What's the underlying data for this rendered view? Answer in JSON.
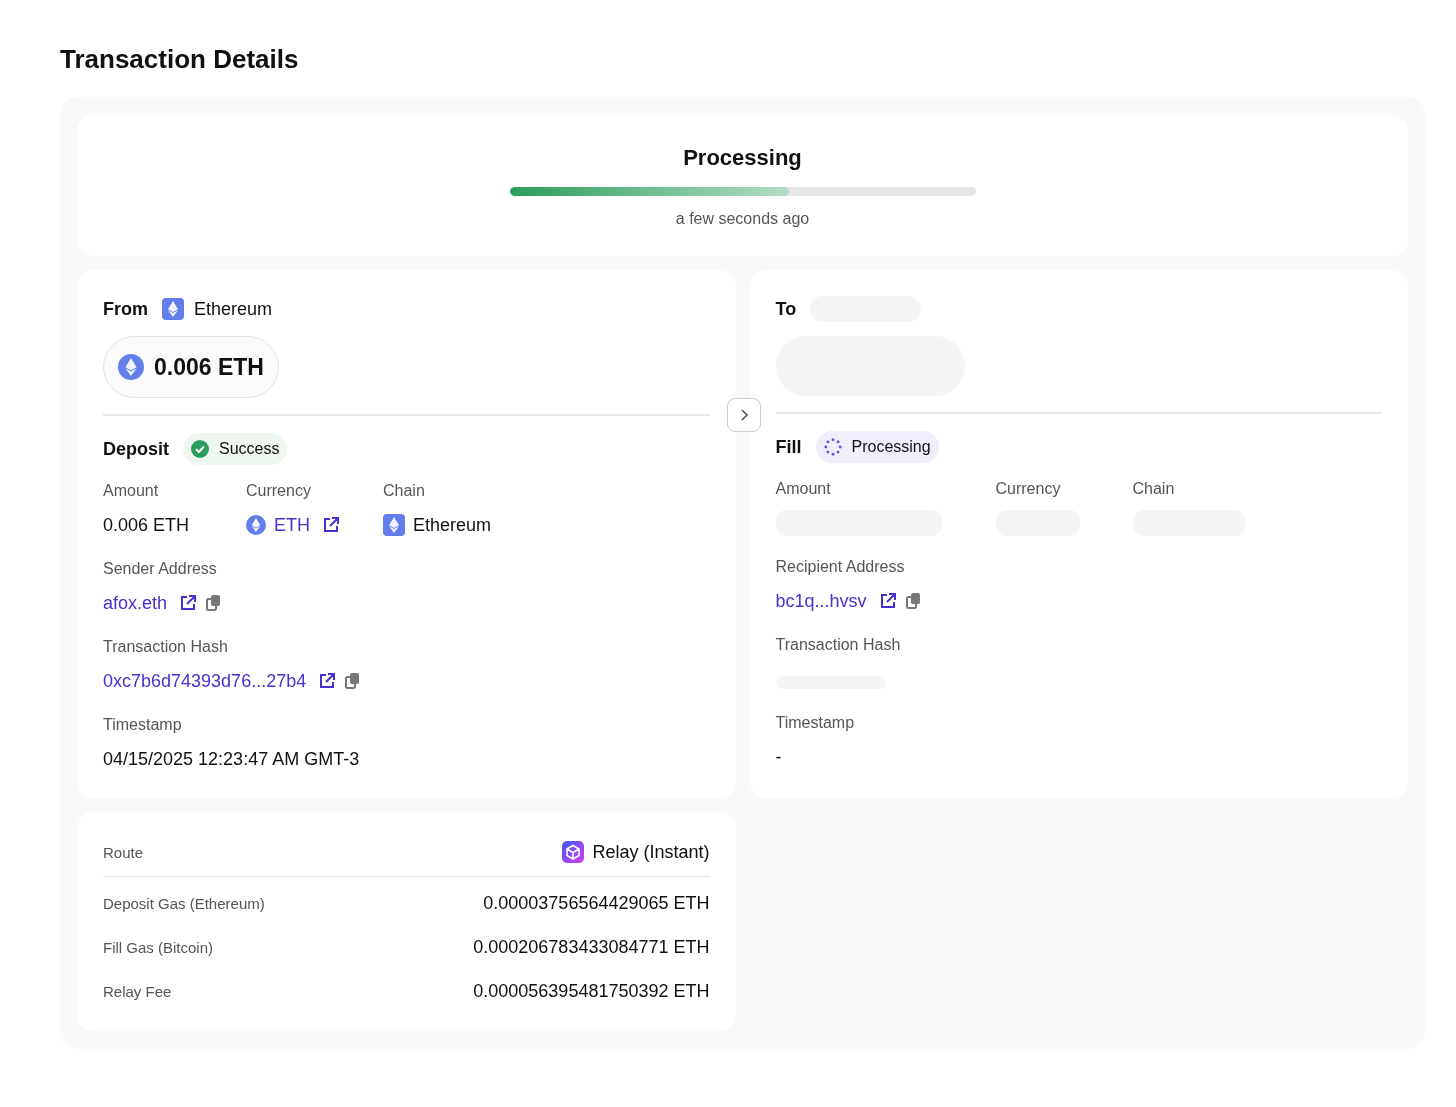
{
  "title": "Transaction Details",
  "status": {
    "title": "Processing",
    "level": 0.6,
    "time": "a few seconds ago"
  },
  "from": {
    "label": "From",
    "chain": "Ethereum",
    "amount": "0.006 ETH"
  },
  "deposit": {
    "label": "Deposit",
    "badge": {
      "kind": "success",
      "text": "Success"
    },
    "columns": [
      {
        "label": "Amount",
        "kind": "text",
        "value": "0.006 ETH"
      },
      {
        "label": "Currency",
        "kind": "token",
        "value": "ETH"
      },
      {
        "label": "Chain",
        "kind": "chain",
        "value": "Ethereum"
      }
    ],
    "fields": [
      {
        "label": "Sender Address",
        "kind": "link",
        "value": "afox.eth"
      },
      {
        "label": "Transaction Hash",
        "kind": "link",
        "value": "0xc7b6d74393d76...27b4"
      },
      {
        "label": "Timestamp",
        "kind": "text",
        "value": "04/15/2025 12:23:47 AM GMT-3"
      }
    ]
  },
  "to": {
    "label": "To"
  },
  "fill": {
    "label": "Fill",
    "badge": {
      "kind": "processing",
      "text": "Processing"
    },
    "columns": [
      {
        "label": "Amount",
        "kind": "loading"
      },
      {
        "label": "Currency",
        "kind": "loading"
      },
      {
        "label": "Chain",
        "kind": "loading"
      }
    ],
    "fields": [
      {
        "label": "Recipient Address",
        "kind": "link",
        "value": "bc1q...hvsv"
      },
      {
        "label": "Transaction Hash",
        "kind": "loading"
      },
      {
        "label": "Timestamp",
        "kind": "text",
        "value": "-"
      }
    ]
  },
  "route": {
    "label": "Route",
    "value": "Relay (Instant)",
    "fees": [
      {
        "label": "Deposit Gas (Ethereum)",
        "value": "0.00003756564429065 ETH"
      },
      {
        "label": "Fill Gas (Bitcoin)",
        "value": "0.000206783433084771 ETH"
      },
      {
        "label": "Relay Fee",
        "value": "0.000056395481750392 ETH"
      }
    ]
  }
}
